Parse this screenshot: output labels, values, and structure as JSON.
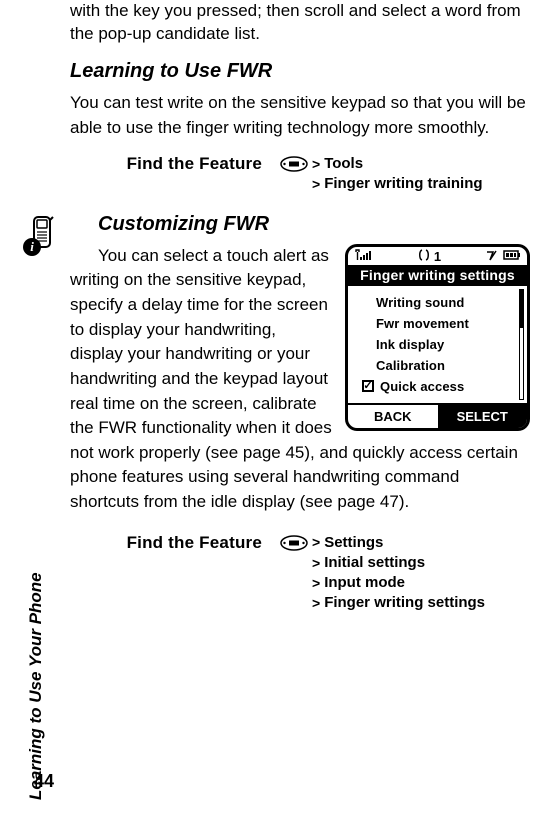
{
  "sideLabel": "Learning to Use Your Phone",
  "pageNumber": "44",
  "intro": "with the key you pressed; then scroll and select a word from the pop-up candidate list.",
  "section1": {
    "heading": "Learning to Use FWR",
    "para": "You can test write on the sensitive keypad so that you will be able to use the finger writing technology more smoothly."
  },
  "feature1": {
    "label": "Find the Feature",
    "path": [
      "Tools",
      "Finger writing training"
    ]
  },
  "section2": {
    "heading": "Customizing FWR",
    "para": "You can select a touch alert as writing on the sensitive keypad, specify a delay time for the screen to display your handwriting, display your handwriting or your handwriting and the keypad layout real time on the screen, calibrate the FWR functionality when it does not work properly (see page 45), and quickly access certain phone features using several handwriting command shortcuts from the idle display (see page 47)."
  },
  "feature2": {
    "label": "Find the Feature",
    "path": [
      "Settings",
      "Initial settings",
      "Input mode",
      "Finger writing settings"
    ]
  },
  "phoneScreen": {
    "status": {
      "carrier1": "1"
    },
    "title": "Finger writing settings",
    "items": [
      "Writing sound",
      "Fwr movement",
      "Ink display",
      "Calibration"
    ],
    "checkedItem": "Quick access",
    "softkeys": {
      "left": "BACK",
      "right": "SELECT"
    }
  }
}
